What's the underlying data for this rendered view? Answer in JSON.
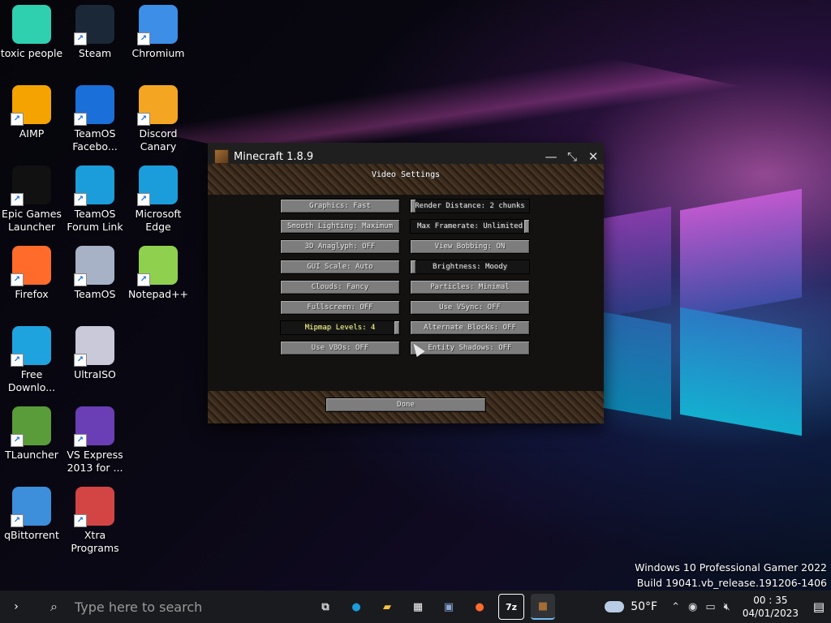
{
  "desktop": {
    "icons": [
      {
        "label": "toxic people",
        "icon": "recycle-bin-icon",
        "color": "#2ed0b0"
      },
      {
        "label": "Steam",
        "icon": "steam-icon",
        "color": "#1b2838"
      },
      {
        "label": "Chromium",
        "icon": "chromium-icon",
        "color": "#3c8ee6"
      },
      {
        "label": "AIMP",
        "icon": "aimp-icon",
        "color": "#f5a300"
      },
      {
        "label": "TeamOS Facebo...",
        "icon": "gear-icon",
        "color": "#1a6fd8"
      },
      {
        "label": "Discord Canary",
        "icon": "discord-icon",
        "color": "#f4a623"
      },
      {
        "label": "Epic Games Launcher",
        "icon": "epic-games-icon",
        "color": "#111111"
      },
      {
        "label": "TeamOS Forum Link",
        "icon": "edge-icon",
        "color": "#1b9ddb"
      },
      {
        "label": "Microsoft Edge",
        "icon": "edge-icon",
        "color": "#1b9ddb"
      },
      {
        "label": "Firefox",
        "icon": "firefox-icon",
        "color": "#ff6b2b"
      },
      {
        "label": "TeamOS",
        "icon": "teamos-icon",
        "color": "#a7b2c6"
      },
      {
        "label": "Notepad++",
        "icon": "notepad-plus-icon",
        "color": "#8fd14f"
      },
      {
        "label": "Free Downlo...",
        "icon": "free-download-icon",
        "color": "#1fa3df"
      },
      {
        "label": "UltraISO",
        "icon": "disc-icon",
        "color": "#c9c9d9"
      },
      {
        "label": "TLauncher",
        "icon": "grass-block-icon",
        "color": "#5a9b3a"
      },
      {
        "label": "VS Express 2013 for ...",
        "icon": "visual-studio-icon",
        "color": "#6a3fb5"
      },
      {
        "label": "qBittorrent",
        "icon": "qbittorrent-icon",
        "color": "#3d8edb"
      },
      {
        "label": "Xtra Programs",
        "icon": "programs-icon",
        "color": "#d34545"
      }
    ]
  },
  "minecraft": {
    "window_title": "Minecraft 1.8.9",
    "screen_title": "Video Settings",
    "options_left": [
      "Graphics: Fast",
      "Smooth Lighting: Maximum",
      "3D Anaglyph: OFF",
      "GUI Scale: Auto",
      "Clouds: Fancy",
      "Fullscreen: OFF",
      "Mipmap Levels: 4",
      "Use VBOs: OFF"
    ],
    "options_right": [
      "Render Distance: 2 chunks",
      "Max Framerate: Unlimited",
      "View Bobbing: ON",
      "Brightness: Moody",
      "Particles: Minimal",
      "Use VSync: OFF",
      "Alternate Blocks: OFF",
      "Entity Shadows: OFF"
    ],
    "done_label": "Done",
    "sliders": {
      "render_distance": 0.0,
      "max_framerate": 1.0,
      "brightness": 0.0,
      "mipmap_levels": 1.0
    }
  },
  "system": {
    "build_line1": "Windows 10 Professional Gamer 2022",
    "build_line2": "Build 19041.vb_release.191206-1406"
  },
  "taskbar": {
    "search_placeholder": "Type here to search",
    "weather": "50°F",
    "time": "00 : 35",
    "date": "04/01/2023"
  }
}
